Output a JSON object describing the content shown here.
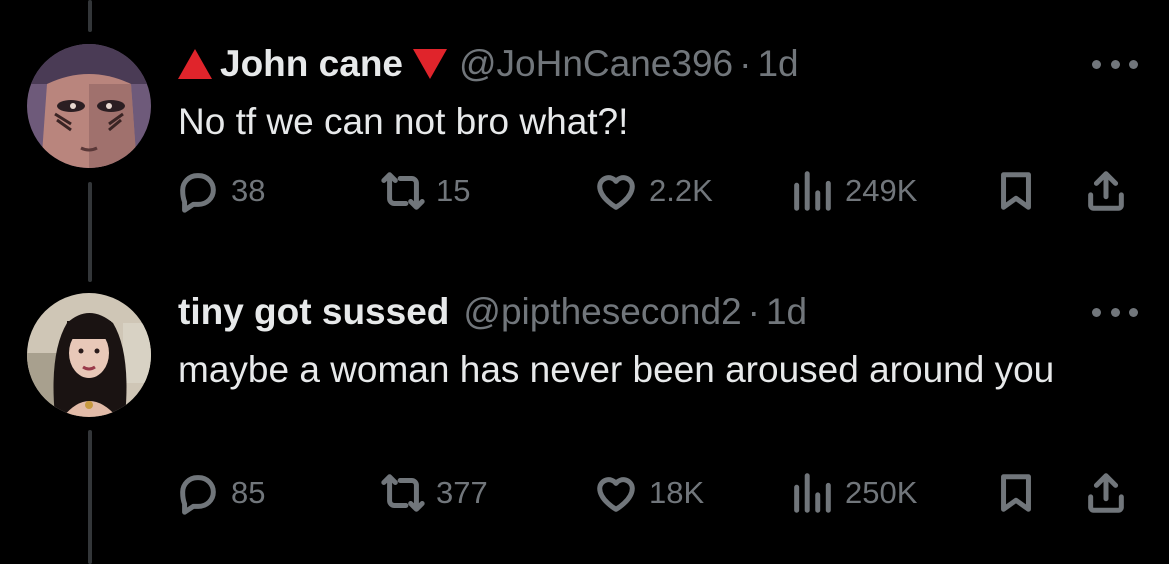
{
  "tweets": [
    {
      "name": "John cane",
      "handle": "@JoHnCane396",
      "time": "1d",
      "text": "No tf we can not bro what?!",
      "replies": "38",
      "reposts": "15",
      "likes": "2.2K",
      "views": "249K"
    },
    {
      "name": "tiny got sussed",
      "handle": "@pipthesecond2",
      "time": "1d",
      "text": "maybe a woman has never been aroused around you",
      "replies": "85",
      "reposts": "377",
      "likes": "18K",
      "views": "250K"
    }
  ],
  "separator": "·",
  "colors": {
    "background": "#000000",
    "text": "#e7e9ea",
    "secondary": "#71767b",
    "accent_red": "#e0242b"
  },
  "icons": [
    "reply-icon",
    "repost-icon",
    "like-icon",
    "views-icon",
    "bookmark-icon",
    "share-icon",
    "more-icon"
  ]
}
